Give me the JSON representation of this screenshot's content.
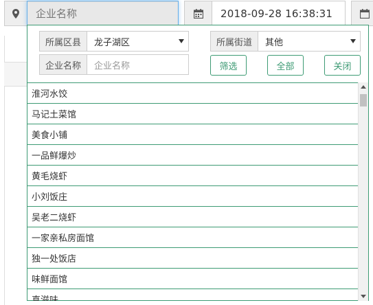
{
  "top_bar": {
    "search_placeholder": "企业名称",
    "datetime": "2018-09-28 16:38:31",
    "icons": {
      "location": "map-marker-icon",
      "calendar": "calendar-icon"
    }
  },
  "dropdown": {
    "district": {
      "label": "所属区县",
      "value": "龙子湖区"
    },
    "street": {
      "label": "所属街道",
      "value": "其他"
    },
    "company": {
      "label": "企业名称",
      "placeholder": "企业名称"
    },
    "buttons": {
      "filter": "筛选",
      "all": "全部",
      "close": "关闭"
    },
    "items": [
      "淮河水饺",
      "马记土菜馆",
      "美食小铺",
      "一品鲜爆炒",
      "黄毛烧虾",
      "小刘饭庄",
      "吴老二烧虾",
      "一家亲私房面馆",
      "独一处饭店",
      "味鲜面馆",
      "真滋味"
    ]
  },
  "colors": {
    "accent": "#3c9a73",
    "focus": "#66afe9"
  }
}
